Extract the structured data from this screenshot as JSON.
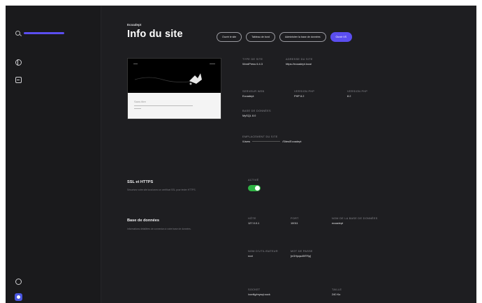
{
  "sidebar": {
    "icons": [
      "search-icon",
      "globe-icon",
      "list-icon",
      "help-icon",
      "account-icon"
    ],
    "accent": "#5b4ef0"
  },
  "header": {
    "site_name": "Ecoadept",
    "title": "Info du site"
  },
  "actions": {
    "open_site": "Ouvrir le site",
    "wp_admin": "Tableau de bord",
    "db_admin": "Administrer la base de données",
    "open_in": "Ouvrir VS",
    "primary_color": "#5b4ef0"
  },
  "preview": {
    "card_title": "Sans titre"
  },
  "site_info": {
    "type": {
      "label": "Type de site",
      "value": "WordPress 6.4.3"
    },
    "url": {
      "label": "Adresse du site",
      "value": "https://ecoadept.local"
    },
    "server": {
      "label": "Serveur web",
      "value": "Ecoadept"
    },
    "php": {
      "label": "Version PHP",
      "value": "PHP 8.2"
    },
    "php_version": {
      "label": "Version PHP",
      "value": "8.2"
    },
    "database": {
      "label": "Base de données",
      "value": "MySQL 8.0"
    },
    "path": {
      "label": "Emplacement du site",
      "value_start": "/Users",
      "value_end": "/Sites/Ecoadept"
    }
  },
  "ssl": {
    "title": "SSL et HTTPS",
    "description": "Sécurisez votre site local avec un certificat SSL pour tester HTTPS.",
    "toggle_label": "Activé",
    "enabled": true,
    "toggle_color": "#2fb344"
  },
  "db": {
    "title": "Base de données",
    "description": "Informations détaillées de connexion à votre base de données.",
    "host": {
      "label": "Hôte",
      "value": "127.0.0.1"
    },
    "port": {
      "label": "Port",
      "value": "10011"
    },
    "name": {
      "label": "Nom de la base de données",
      "value": "ecoadept"
    },
    "user": {
      "label": "Nom d'utilisateur",
      "value": "root"
    },
    "password": {
      "label": "Mot de passe",
      "value": "[nGHpqsd5fTRp]"
    },
    "socket": {
      "label": "Socket",
      "value": "/config/mysql.sock"
    },
    "size": {
      "label": "Taille",
      "value": "240 Ko"
    }
  }
}
